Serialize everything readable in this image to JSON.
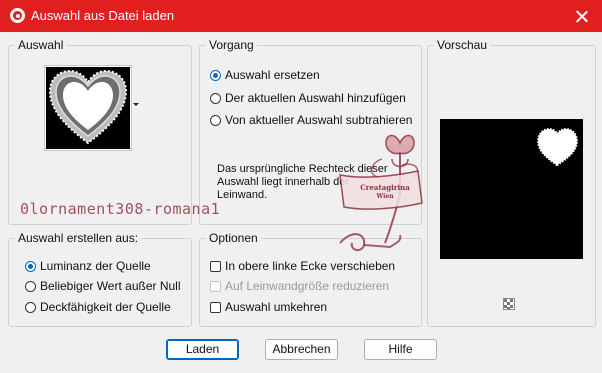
{
  "window": {
    "title": "Auswahl aus Datei laden"
  },
  "auswahl": {
    "legend": "Auswahl"
  },
  "vorgang": {
    "legend": "Vorgang",
    "options": [
      "Auswahl ersetzen",
      "Der aktuellen Auswahl hinzufügen",
      "Von aktueller Auswahl subtrahieren"
    ],
    "selected": 0,
    "info": "Das ursprüngliche Rechteck dieser Auswahl liegt innerhalb der Leinwand."
  },
  "vorschau": {
    "legend": "Vorschau"
  },
  "erstellen": {
    "legend": "Auswahl erstellen aus:",
    "options": [
      "Luminanz der Quelle",
      "Beliebiger Wert außer Null",
      "Deckfähigkeit der Quelle"
    ],
    "selected": 0
  },
  "optionen": {
    "legend": "Optionen",
    "items": [
      {
        "label": "In obere linke Ecke verschieben",
        "checked": false,
        "disabled": false
      },
      {
        "label": "Auf Leinwandgröße reduzieren",
        "checked": false,
        "disabled": true
      },
      {
        "label": "Auswahl umkehren",
        "checked": false,
        "disabled": false
      }
    ]
  },
  "buttons": {
    "load": "Laden",
    "cancel": "Abbrechen",
    "help": "Hilfe"
  },
  "watermark": {
    "filename": "0lornament308-romana1",
    "signature_line1": "Creatagirina",
    "signature_line2": "Wien"
  },
  "colors": {
    "titlebar": "#e21f1f",
    "accent": "#0067c0"
  }
}
